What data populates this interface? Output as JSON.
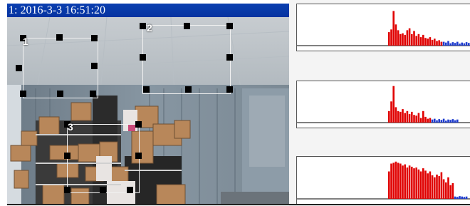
{
  "camera": {
    "title": "1: 2016-3-3 16:51:20"
  },
  "zones": [
    {
      "label": "1"
    },
    {
      "label": "2"
    },
    {
      "label": "3"
    }
  ],
  "histograms": [
    {
      "baseline_color": "#808080",
      "bar_color": "#e00000",
      "tail_color": "#1e3cd0",
      "red_values": [
        0.35,
        0.42,
        0.9,
        0.55,
        0.4,
        0.3,
        0.32,
        0.28,
        0.4,
        0.45,
        0.3,
        0.38,
        0.25,
        0.3,
        0.22,
        0.28,
        0.2,
        0.18,
        0.22,
        0.15,
        0.18,
        0.12,
        0.14,
        0.1
      ],
      "blue_values": [
        0.1,
        0.08,
        0.12,
        0.06,
        0.09,
        0.07,
        0.1,
        0.05,
        0.08,
        0.06,
        0.09,
        0.07
      ]
    },
    {
      "baseline_color": "#808080",
      "bar_color": "#e00000",
      "tail_color": "#1e3cd0",
      "red_values": [
        0.3,
        0.55,
        0.95,
        0.4,
        0.3,
        0.28,
        0.35,
        0.25,
        0.3,
        0.22,
        0.28,
        0.2,
        0.18,
        0.25,
        0.12,
        0.3,
        0.15,
        0.1,
        0.12
      ],
      "blue_values": [
        0.08,
        0.1,
        0.06,
        0.09,
        0.07,
        0.1,
        0.05,
        0.08,
        0.07,
        0.09,
        0.06,
        0.08
      ]
    },
    {
      "baseline_color": "#808080",
      "bar_color": "#e00000",
      "tail_color": "#1e3cd0",
      "red_values": [
        0.7,
        0.9,
        0.92,
        0.95,
        0.92,
        0.9,
        0.85,
        0.88,
        0.8,
        0.85,
        0.82,
        0.78,
        0.8,
        0.75,
        0.7,
        0.78,
        0.72,
        0.65,
        0.7,
        0.6,
        0.55,
        0.62,
        0.58,
        0.68,
        0.5,
        0.42,
        0.55,
        0.35,
        0.4
      ],
      "blue_values": [
        0.06,
        0.05,
        0.07,
        0.06,
        0.05,
        0.06
      ]
    }
  ]
}
